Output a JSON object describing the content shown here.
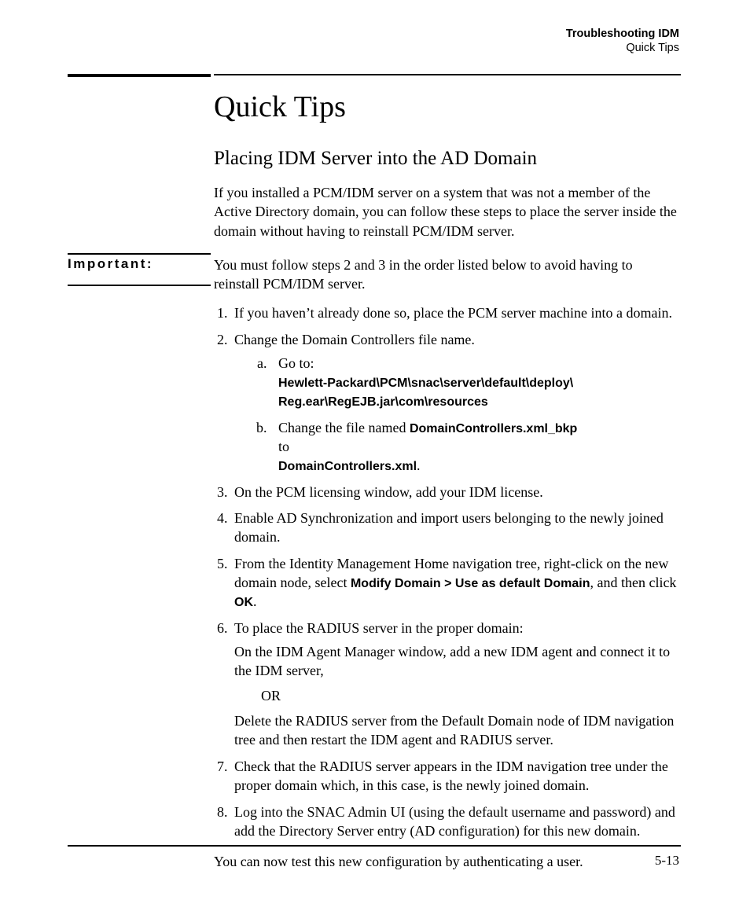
{
  "header": {
    "bold": "Troubleshooting IDM",
    "sub": "Quick Tips"
  },
  "title": "Quick Tips",
  "subtitle": "Placing IDM Server into the AD Domain",
  "intro": "If you installed a PCM/IDM server on a system that was not a member of the Active Directory domain, you can follow these steps to place the server inside the domain without having to reinstall PCM/IDM server.",
  "sidebar_label": "Important:",
  "important": "You must follow steps 2 and 3 in the order listed below to avoid having to reinstall PCM/IDM server.",
  "steps": {
    "s1": "If you haven’t already done so, place the PCM server machine into a domain.",
    "s2": "Change the Domain Controllers file name.",
    "s2a_lead": "Go to:",
    "s2a_path1": "Hewlett-Packard\\PCM\\snac\\server\\default\\deploy\\",
    "s2a_path2": "Reg.ear\\RegEJB.jar\\com\\resources",
    "s2b_pre": "Change the file named ",
    "s2b_file1": "DomainControllers.xml_bkp",
    "s2b_mid": "to",
    "s2b_file2": "DomainControllers.xml",
    "s2b_post": ".",
    "s3": "On the PCM licensing window, add your IDM license.",
    "s4": "Enable AD Synchronization and import users belonging to the newly joined domain.",
    "s5_pre": "From the Identity Management Home navigation tree, right-click on the new domain node, select ",
    "s5_bold1": "Modify Domain > Use as default Domain",
    "s5_mid": ", and then click ",
    "s5_bold2": "OK",
    "s5_post": ".",
    "s6": "To place the RADIUS server in the proper domain:",
    "s6_sub1": "On the IDM Agent Manager window, add a new IDM agent and connect it to the IDM server,",
    "s6_or": "OR",
    "s6_sub2": "Delete the RADIUS server from the Default Domain node of IDM navigation tree and then restart the IDM agent and RADIUS server.",
    "s7": "Check that the RADIUS server appears in the IDM navigation tree under the proper domain which, in this case, is the newly joined domain.",
    "s8": "Log into the SNAC Admin UI (using the default username and password) and add the Directory Server entry (AD configuration) for this new domain."
  },
  "closing": "You can now test this new configuration by authenticating a user.",
  "page_num": "5-13"
}
